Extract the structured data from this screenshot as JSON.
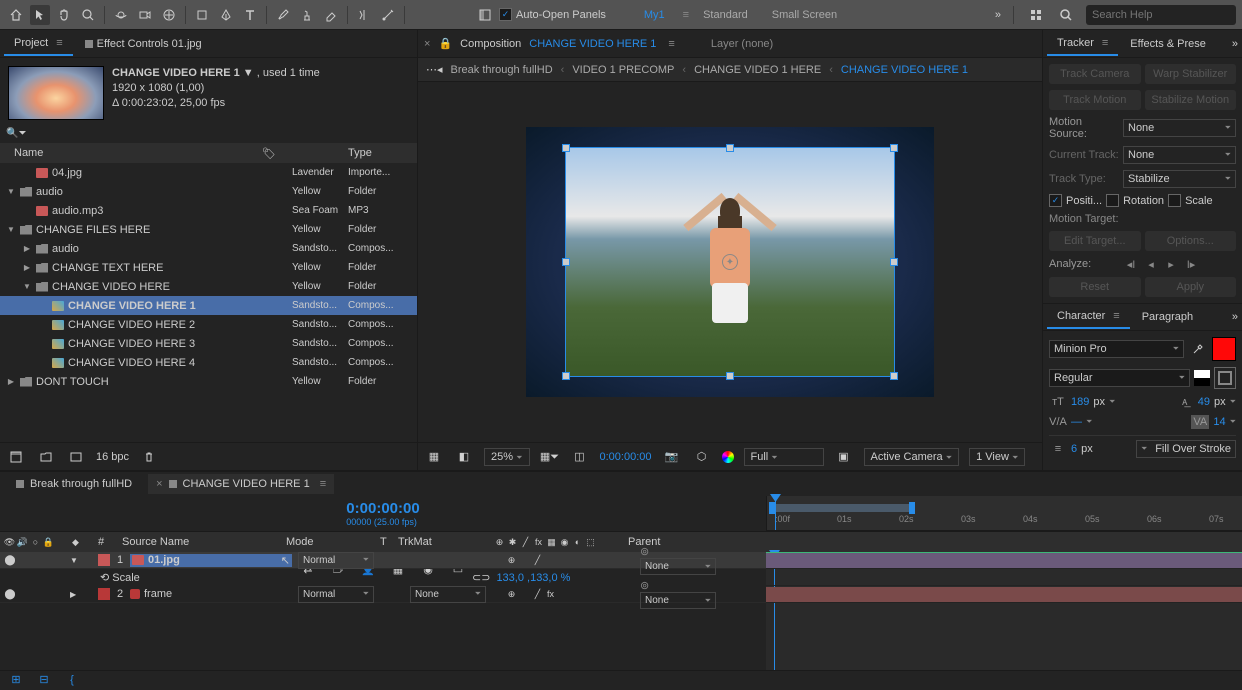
{
  "toolbar": {
    "auto_open": "Auto-Open Panels",
    "workspaces": [
      "My1",
      "Standard",
      "Small Screen"
    ],
    "search_placeholder": "Search Help"
  },
  "project": {
    "tab_project": "Project",
    "tab_effect": "Effect Controls 01.jpg",
    "title": "CHANGE VIDEO HERE 1",
    "usage": ", used 1 time",
    "dims": "1920 x 1080 (1,00)",
    "duration": "Δ 0:00:23:02, 25,00 fps",
    "cols": {
      "name": "Name",
      "label": "",
      "type": "Type"
    },
    "items": [
      {
        "indent": 1,
        "icon": "img",
        "name": "04.jpg",
        "color": "#c8a0e8",
        "colorName": "Lavender",
        "type": "Importe..."
      },
      {
        "indent": 0,
        "twirl": "▼",
        "icon": "folder",
        "name": "audio",
        "color": "#e8d060",
        "colorName": "Yellow",
        "type": "Folder"
      },
      {
        "indent": 1,
        "icon": "img",
        "name": "audio.mp3",
        "color": "#60c8a8",
        "colorName": "Sea Foam",
        "type": "MP3"
      },
      {
        "indent": 0,
        "twirl": "▼",
        "icon": "folder",
        "name": "CHANGE FILES HERE",
        "color": "#e8d060",
        "colorName": "Yellow",
        "type": "Folder"
      },
      {
        "indent": 1,
        "twirl": "▶",
        "icon": "folder",
        "name": "audio",
        "color": "#c8a070",
        "colorName": "Sandsto...",
        "type": "Compos..."
      },
      {
        "indent": 1,
        "twirl": "▶",
        "icon": "folder",
        "name": "CHANGE TEXT HERE",
        "color": "#e8d060",
        "colorName": "Yellow",
        "type": "Folder"
      },
      {
        "indent": 1,
        "twirl": "▼",
        "icon": "folder",
        "name": "CHANGE VIDEO HERE",
        "color": "#e8d060",
        "colorName": "Yellow",
        "type": "Folder"
      },
      {
        "indent": 2,
        "icon": "comp",
        "name": "CHANGE VIDEO HERE 1",
        "color": "#c8a070",
        "colorName": "Sandsto...",
        "type": "Compos...",
        "sel": true,
        "bold": true
      },
      {
        "indent": 2,
        "icon": "comp",
        "name": "CHANGE VIDEO HERE 2",
        "color": "#c8a070",
        "colorName": "Sandsto...",
        "type": "Compos..."
      },
      {
        "indent": 2,
        "icon": "comp",
        "name": "CHANGE VIDEO HERE 3",
        "color": "#c8a070",
        "colorName": "Sandsto...",
        "type": "Compos..."
      },
      {
        "indent": 2,
        "icon": "comp",
        "name": "CHANGE VIDEO HERE 4",
        "color": "#c8a070",
        "colorName": "Sandsto...",
        "type": "Compos..."
      },
      {
        "indent": 0,
        "twirl": "▶",
        "icon": "folder",
        "name": "DONT TOUCH",
        "color": "#e8d060",
        "colorName": "Yellow",
        "type": "Folder"
      }
    ],
    "footer_bpc": "16 bpc"
  },
  "comp": {
    "tab_prefix": "Composition",
    "tab_name": "CHANGE VIDEO HERE 1",
    "tab_layer": "Layer (none)",
    "breadcrumb": [
      "Break through fullHD",
      "VIDEO 1 PRECOMP",
      "CHANGE VIDEO 1 HERE",
      "CHANGE VIDEO HERE 1"
    ],
    "footer": {
      "zoom": "25%",
      "tc": "0:00:00:00",
      "res": "Full",
      "camera": "Active Camera",
      "view": "1 View"
    }
  },
  "tracker": {
    "tab_tracker": "Tracker",
    "tab_effects": "Effects & Prese",
    "btn_camera": "Track Camera",
    "btn_warp": "Warp Stabilizer",
    "btn_motion": "Track Motion",
    "btn_stab": "Stabilize Motion",
    "lbl_source": "Motion Source:",
    "val_source": "None",
    "lbl_track": "Current Track:",
    "val_track": "None",
    "lbl_type": "Track Type:",
    "val_type": "Stabilize",
    "chk_pos": "Positi...",
    "chk_rot": "Rotation",
    "chk_scale": "Scale",
    "lbl_target": "Motion Target:",
    "btn_edit": "Edit Target...",
    "btn_options": "Options...",
    "lbl_analyze": "Analyze:",
    "btn_reset": "Reset",
    "btn_apply": "Apply"
  },
  "character": {
    "tab_char": "Character",
    "tab_para": "Paragraph",
    "font": "Minion Pro",
    "style": "Regular",
    "fill": "#ff0808",
    "stroke": "#ffffff",
    "size": "189",
    "leading": "49",
    "tracking": "—",
    "kerning": "14",
    "stroke_w": "6",
    "stroke_style": "Fill Over Stroke",
    "px": "px"
  },
  "timeline": {
    "tabs": [
      "Break through fullHD",
      "CHANGE VIDEO HERE 1"
    ],
    "tc": "0:00:00:00",
    "tc_sub": "00000 (25.00 fps)",
    "cols": {
      "num": "#",
      "name": "Source Name",
      "mode": "Mode",
      "t": "T",
      "trk": "TrkMat",
      "parent": "Parent"
    },
    "layers": [
      {
        "num": "1",
        "name": "01.jpg",
        "mode": "Normal",
        "trk": "",
        "parent": "None",
        "color": "#c85858",
        "sel": true,
        "editing": true,
        "icon": "img"
      },
      {
        "prop": "Scale",
        "val": "133,0 ,133,0 %"
      },
      {
        "num": "2",
        "name": "frame",
        "mode": "Normal",
        "trk": "None",
        "parent": "None",
        "color": "#b83838",
        "icon": "solid"
      }
    ],
    "ruler": [
      ":00f",
      "01s",
      "02s",
      "03s",
      "04s",
      "05s",
      "06s",
      "07s"
    ]
  }
}
